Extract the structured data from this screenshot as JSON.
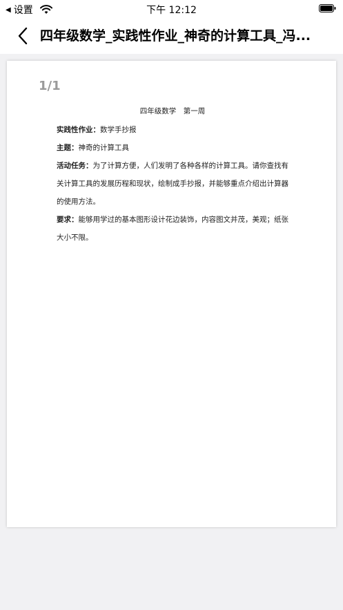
{
  "status_bar": {
    "back_label": "设置",
    "time": "下午 12:12"
  },
  "nav": {
    "title": "四年级数学_实践性作业_神奇的计算工具_冯..."
  },
  "viewer": {
    "page_indicator": "1/1"
  },
  "document": {
    "heading": "四年级数学　第一周",
    "items": [
      {
        "label": "实践性作业：",
        "text": "数学手抄报"
      },
      {
        "label": "主题：",
        "text": "神奇的计算工具"
      },
      {
        "label": "活动任务：",
        "text": "为了计算方便，人们发明了各种各样的计算工具。请你查找有关计算工具的发展历程和现状，绘制成手抄报，并能够重点介绍出计算器的使用方法。"
      },
      {
        "label": "要求：",
        "text": "能够用学过的基本图形设计花边装饰，内容图文并茂，美观；纸张大小不限。"
      }
    ]
  },
  "colors": {
    "background": "#f1f1f3",
    "page": "#ffffff",
    "page_indicator": "#9a9a9a"
  }
}
